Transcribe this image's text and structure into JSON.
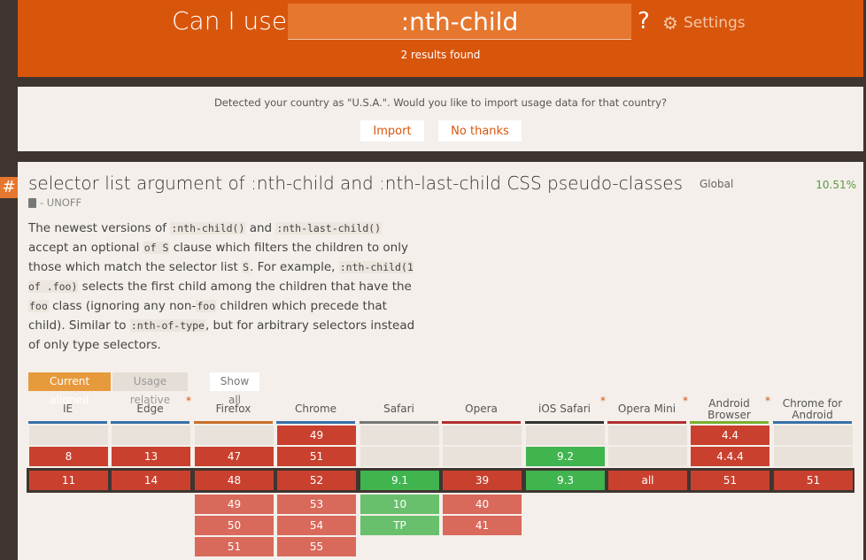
{
  "header": {
    "title": "Can I use",
    "search_value": ":nth-child",
    "help": "?",
    "settings_label": "Settings",
    "results_text": "2 results found"
  },
  "country_prompt": {
    "message": "Detected your country as \"U.S.A.\". Would you like to import usage data for that country?",
    "import_label": "Import",
    "no_thanks_label": "No thanks"
  },
  "feature": {
    "anchor": "#",
    "title": "selector list argument of :nth-child and :nth-last-child CSS pseudo-classes",
    "status": "- UNOFF",
    "global_label": "Global",
    "global_pct": "10.51%",
    "description": [
      {
        "t": "text",
        "v": "The newest versions of "
      },
      {
        "t": "code",
        "v": ":nth-child()"
      },
      {
        "t": "text",
        "v": " and "
      },
      {
        "t": "code",
        "v": ":nth-last-child()"
      },
      {
        "t": "text",
        "v": " accept an optional "
      },
      {
        "t": "code",
        "v": "of S"
      },
      {
        "t": "text",
        "v": " clause which filters the children to only those which match the selector list "
      },
      {
        "t": "code",
        "v": "S"
      },
      {
        "t": "text",
        "v": ". For example, "
      },
      {
        "t": "code",
        "v": ":nth-child(1 of .foo)"
      },
      {
        "t": "text",
        "v": " selects the first child among the children that have the "
      },
      {
        "t": "code",
        "v": "foo"
      },
      {
        "t": "text",
        "v": " class (ignoring any non-"
      },
      {
        "t": "code",
        "v": "foo"
      },
      {
        "t": "text",
        "v": " children which precede that child). Similar to "
      },
      {
        "t": "code",
        "v": ":nth-of-type"
      },
      {
        "t": "text",
        "v": ", but for arbitrary selectors instead of only type selectors."
      }
    ],
    "modes": {
      "current": "Current aligned",
      "relative": "Usage relative",
      "show_all": "Show all"
    }
  },
  "browsers": [
    {
      "name": "IE",
      "star": false,
      "bar": "#3870a8",
      "cells": [
        {
          "row": 1,
          "v": "",
          "s": "empty"
        },
        {
          "row": 2,
          "v": "8",
          "s": "n"
        },
        {
          "row": 3,
          "v": "11",
          "s": "n"
        }
      ]
    },
    {
      "name": "Edge",
      "star": true,
      "bar": "#3870a8",
      "cells": [
        {
          "row": 1,
          "v": "",
          "s": "empty"
        },
        {
          "row": 2,
          "v": "13",
          "s": "n"
        },
        {
          "row": 3,
          "v": "14",
          "s": "n"
        }
      ]
    },
    {
      "name": "Firefox",
      "star": false,
      "bar": "#c8702a",
      "cells": [
        {
          "row": 1,
          "v": "",
          "s": "empty"
        },
        {
          "row": 2,
          "v": "47",
          "s": "n"
        },
        {
          "row": 3,
          "v": "48",
          "s": "n"
        },
        {
          "row": 4,
          "v": "49",
          "s": "nl"
        },
        {
          "row": 5,
          "v": "50",
          "s": "nl"
        },
        {
          "row": 6,
          "v": "51",
          "s": "nl"
        }
      ]
    },
    {
      "name": "Chrome",
      "star": false,
      "bar": "#3870a8",
      "cells": [
        {
          "row": 1,
          "v": "49",
          "s": "n"
        },
        {
          "row": 2,
          "v": "51",
          "s": "n"
        },
        {
          "row": 3,
          "v": "52",
          "s": "n"
        },
        {
          "row": 4,
          "v": "53",
          "s": "nl"
        },
        {
          "row": 5,
          "v": "54",
          "s": "nl"
        },
        {
          "row": 6,
          "v": "55",
          "s": "nl"
        }
      ]
    },
    {
      "name": "Safari",
      "star": false,
      "bar": "#777777",
      "cells": [
        {
          "row": 1,
          "v": "",
          "s": "empty"
        },
        {
          "row": 2,
          "v": "",
          "s": "empty"
        },
        {
          "row": 3,
          "v": "9.1",
          "s": "y"
        },
        {
          "row": 4,
          "v": "10",
          "s": "yl"
        },
        {
          "row": 5,
          "v": "TP",
          "s": "yl"
        }
      ]
    },
    {
      "name": "Opera",
      "star": false,
      "bar": "#b03030",
      "cells": [
        {
          "row": 1,
          "v": "",
          "s": "empty"
        },
        {
          "row": 2,
          "v": "",
          "s": "empty"
        },
        {
          "row": 3,
          "v": "39",
          "s": "n"
        },
        {
          "row": 4,
          "v": "40",
          "s": "nl"
        },
        {
          "row": 5,
          "v": "41",
          "s": "nl"
        }
      ]
    },
    {
      "name": "iOS Safari",
      "star": true,
      "bar": "#333333",
      "cells": [
        {
          "row": 1,
          "v": "",
          "s": "empty"
        },
        {
          "row": 2,
          "v": "9.2",
          "s": "y"
        },
        {
          "row": 3,
          "v": "9.3",
          "s": "y"
        }
      ]
    },
    {
      "name": "Opera Mini",
      "star": true,
      "bar": "#b03030",
      "cells": [
        {
          "row": 1,
          "v": "",
          "s": "empty"
        },
        {
          "row": 2,
          "v": "",
          "s": "empty"
        },
        {
          "row": 3,
          "v": "all",
          "s": "n"
        }
      ]
    },
    {
      "name": "Android Browser",
      "star": true,
      "bar": "#78b030",
      "cells": [
        {
          "row": 1,
          "v": "4.4",
          "s": "n"
        },
        {
          "row": 2,
          "v": "4.4.4",
          "s": "n"
        },
        {
          "row": 3,
          "v": "51",
          "s": "n"
        }
      ]
    },
    {
      "name": "Chrome for Android",
      "star": false,
      "bar": "#3870a8",
      "cells": [
        {
          "row": 1,
          "v": "",
          "s": "empty"
        },
        {
          "row": 2,
          "v": "",
          "s": "empty"
        },
        {
          "row": 3,
          "v": "51",
          "s": "n"
        }
      ]
    }
  ]
}
